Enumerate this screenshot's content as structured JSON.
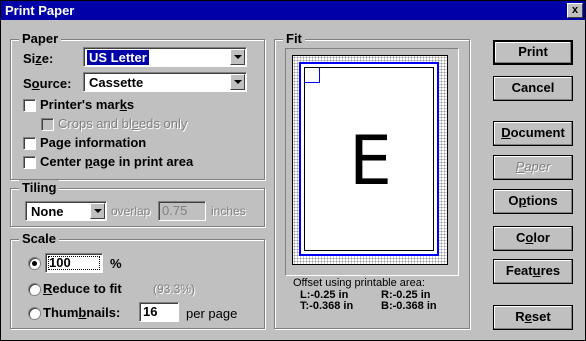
{
  "window": {
    "title": "Print Paper",
    "close_label": "x"
  },
  "paper": {
    "group_title": "Paper",
    "size_label_pre": "Si",
    "size_label_u": "z",
    "size_label_post": "e:",
    "size_value": "US Letter",
    "source_label_pre": "S",
    "source_label_u": "o",
    "source_label_post": "urce:",
    "source_value": "Cassette",
    "printers_marks_pre": "Printer's mar",
    "printers_marks_u": "k",
    "printers_marks_post": "s",
    "printers_marks_checked": false,
    "crops_pre": "Crops and bl",
    "crops_u": "e",
    "crops_post": "eds only",
    "crops_checked": false,
    "page_info_pre": "Pa",
    "page_info_u": "g",
    "page_info_post": "e information",
    "page_info_checked": false,
    "center_pre": "Center ",
    "center_u": "p",
    "center_post": "age in print area",
    "center_checked": false
  },
  "tiling": {
    "group_title": "Tiling",
    "mode_value": "None",
    "overlap_label": "overlap",
    "overlap_value": "0.75",
    "overlap_unit": "inches"
  },
  "scale": {
    "group_title": "Scale",
    "percent_value": "100",
    "percent_unit": "%",
    "reduce_pre": "",
    "reduce_u": "R",
    "reduce_post": "educe to fit",
    "reduce_percent": "(93.3%)",
    "thumbs_pre": "Thum",
    "thumbs_u": "b",
    "thumbs_post": "nails:",
    "thumbs_value": "16",
    "thumbs_unit": "per page",
    "selected": "percent"
  },
  "fit": {
    "group_title": "Fit",
    "preview_letter": "E",
    "offset_caption": "Offset using printable area:",
    "left_offset": "L:-0.25 in",
    "right_offset": "R:-0.25 in",
    "top_offset": "T:-0.368 in",
    "bottom_offset": "B:-0.368 in"
  },
  "buttons": {
    "print": "Print",
    "cancel": "Cancel",
    "document_u": "D",
    "document_post": "ocument",
    "paper_u": "P",
    "paper_post": "aper",
    "options_pre": "O",
    "options_u": "p",
    "options_post": "tions",
    "color_pre": "C",
    "color_u": "o",
    "color_post": "lor",
    "features_pre": "Feat",
    "features_u": "u",
    "features_post": "res",
    "reset_pre": "R",
    "reset_u": "e",
    "reset_post": "set"
  },
  "colors": {
    "title_bar": "#0000a8",
    "face": "#c0c0c0",
    "preview_outline": "#0000ff"
  }
}
